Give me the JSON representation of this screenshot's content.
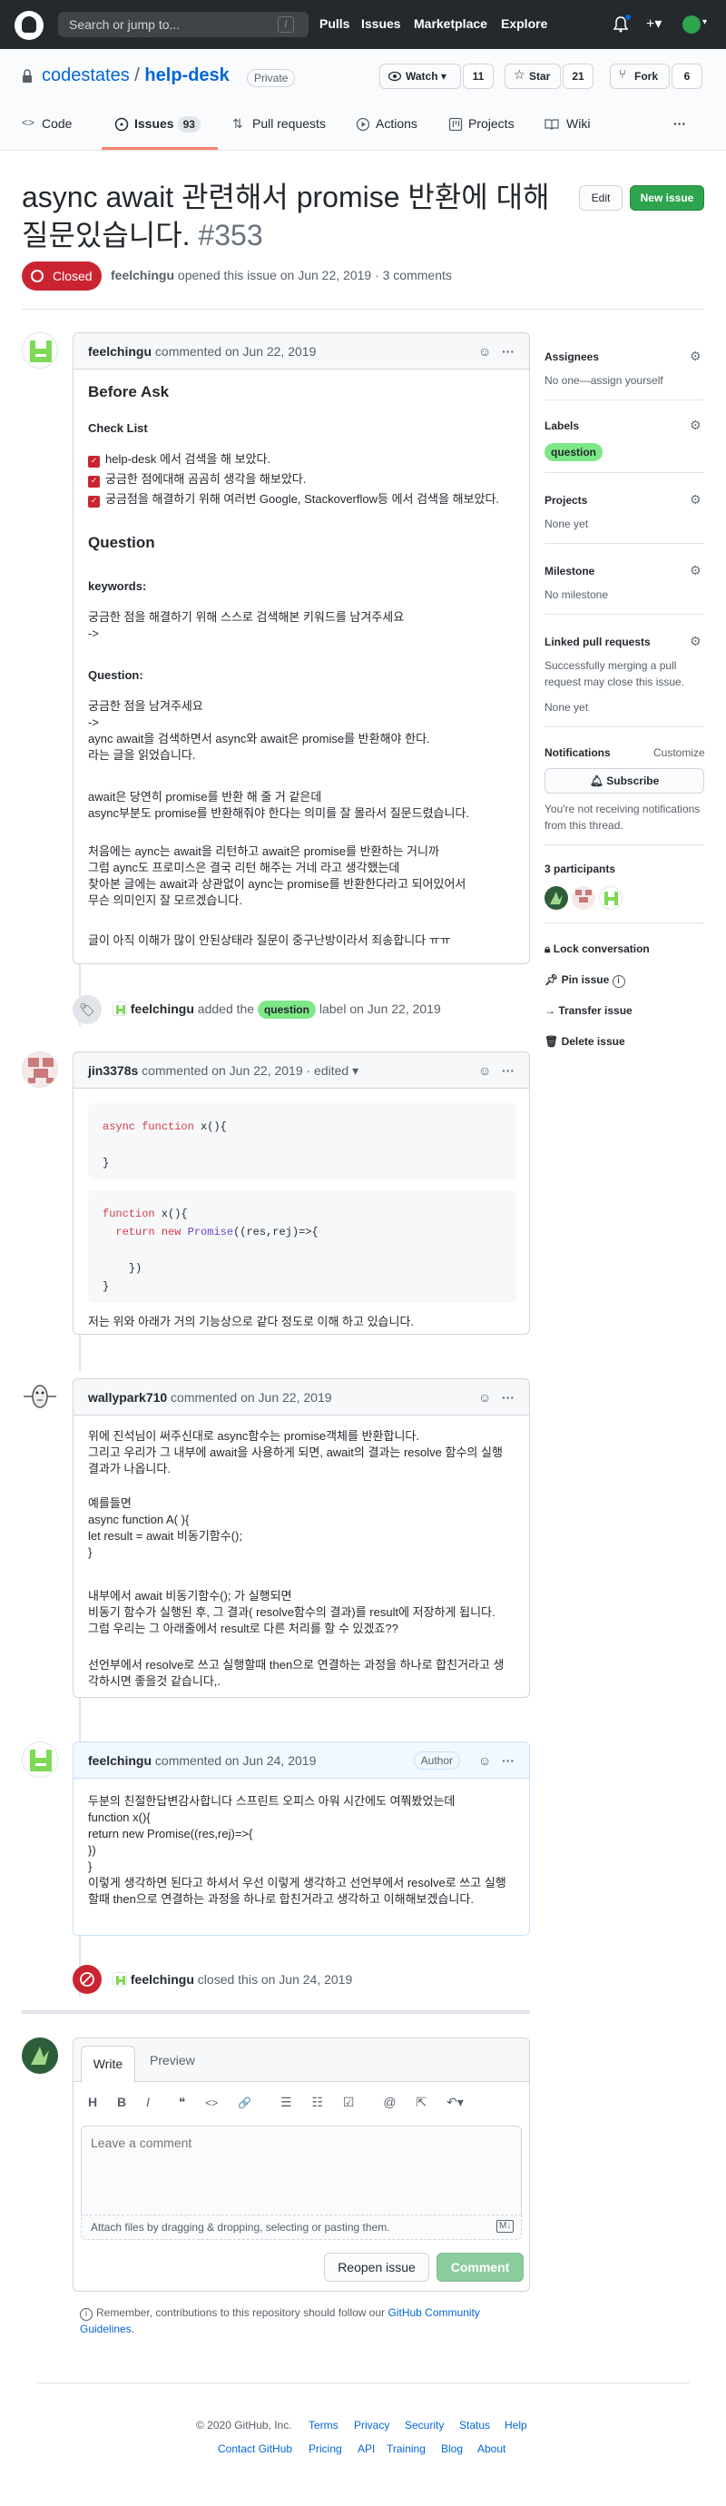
{
  "header": {
    "search_placeholder": "Search or jump to...",
    "search_key": "/",
    "nav": [
      "Pulls",
      "Issues",
      "Marketplace",
      "Explore"
    ]
  },
  "repo": {
    "owner": "codestates",
    "sep": "/",
    "name": "help-desk",
    "visibility": "Private",
    "watch_label": "Watch",
    "watch_count": "11",
    "star_label": "Star",
    "star_count": "21",
    "fork_label": "Fork",
    "fork_count": "6",
    "tabs": [
      {
        "label": "Code"
      },
      {
        "label": "Issues",
        "count": "93"
      },
      {
        "label": "Pull requests"
      },
      {
        "label": "Actions"
      },
      {
        "label": "Projects"
      },
      {
        "label": "Wiki"
      }
    ],
    "more": "···"
  },
  "issue": {
    "title": "async await 관련해서 promise 반환에 대해 질문있습니다.",
    "number": "#353",
    "edit_label": "Edit",
    "new_issue_label": "New issue",
    "state": "Closed",
    "author": "feelchingu",
    "meta_text": " opened this issue on Jun 22, 2019 · 3 comments"
  },
  "comments": [
    {
      "author": "feelchingu",
      "meta": " commented on Jun 22, 2019",
      "h_before": "Before Ask",
      "checklist_title": "Check List",
      "checklist": [
        "help-desk 에서 검색을 해 보았다.",
        "궁금한 점에대해 곰곰히 생각을 해보았다.",
        "궁금점을 해결하기 위해 여러번 Google, Stackoverflow등 에서 검색을 해보았다."
      ],
      "h_question": "Question",
      "keywords_label": "keywords:",
      "keywords_lines": [
        "궁금한 점을 해결하기 위해 스스로 검색해본 키워드를 남겨주세요",
        "->"
      ],
      "question_label": "Question:",
      "para1": [
        "궁금한 점을 남겨주세요",
        "->",
        "aync await을 검색하면서 async와 await은 promise를 반환해야 한다.",
        "라는 글을 읽었습니다."
      ],
      "para2": [
        "await은 당연히 promise를 반환 해 줄 거 같은데",
        "async부분도 promise를 반환해줘야 한다는 의미를 잘 몰라서 질문드렸습니다."
      ],
      "para3": [
        "처음에는 aync는 await을 리턴하고 await은 promise를 반환하는 거니까",
        "그럼 aync도 프로미스은 결국 리턴 해주는 거네 라고 생각했는데",
        "찾아본 글에는 await과 상관없이 aync는 promise를 반환한다라고 되어있어서",
        "무슨 의미인지 잘 모르겠습니다."
      ],
      "para4": "글이 아직 이해가 많이 안된상태라 질문이 중구난방이라서 죄송합니다 ㅠㅠ"
    },
    {
      "author": "jin3378s",
      "meta": " commented on Jun 22, 2019 · edited ▾",
      "code1": {
        "kw": "async",
        "fn": "function",
        "rest": " x(){",
        "close": "}"
      },
      "code2": {
        "fn": "function",
        "rest": " x(){",
        "ret": "return",
        "new": "new",
        "cls": "Promise",
        "args": "((res,rej)=>{",
        "close1": "})",
        "close2": "}"
      },
      "text": "저는 위와 아래가 거의 기능상으로 같다 정도로 이해 하고 있습니다."
    },
    {
      "author": "wallypark710",
      "meta": " commented on Jun 22, 2019",
      "p1": [
        "위에 진석님이 써주신대로 async함수는 promise객체를 반환합니다.",
        "그리고 우리가 그 내부에 await을 사용하게 되면, await의 결과는 resolve 함수의 실행",
        "결과가 나옵니다."
      ],
      "p2": [
        "예를들면",
        "async function A( ){",
        "let result = await 비동기함수();",
        "}"
      ],
      "p3": [
        "내부에서 await 비동기함수(); 가 실행되면",
        "비동기 함수가 실행된 후, 그 결과( resolve함수의 결과)를 result에 저장하게 됩니다.",
        "그럼 우리는 그 아래줄에서 result로 다른 처리를 할 수 있겠죠??"
      ],
      "p4": [
        "선언부에서 resolve로 쓰고 실행할때 then으로 연결하는 과정을 하나로 합친거라고 생",
        "각하시면 좋을것 같습니다,."
      ]
    },
    {
      "author": "feelchingu",
      "meta": " commented on Jun 24, 2019",
      "role": "Author",
      "lines": [
        "두분의 친절한답변감사합니다 스프린트 오피스 아워 시간에도 여쭤봤었는데",
        "function x(){",
        "return new Promise((res,rej)=>{",
        "})",
        "}",
        "이렇게 생각하면 된다고 하셔서 우선 이렇게 생각하고 선언부에서 resolve로 쓰고 실행",
        "할때 then으로 연결하는 과정을 하나로 합친거라고 생각하고 이해해보겠습니다."
      ]
    }
  ],
  "events": {
    "labeled": {
      "actor": "feelchingu",
      "pre": " added the ",
      "label": "question",
      "post": " label on Jun 22, 2019"
    },
    "closed": {
      "actor": "feelchingu",
      "text": " closed this on Jun 24, 2019"
    }
  },
  "editor": {
    "tab_write": "Write",
    "tab_preview": "Preview",
    "tools": [
      "H",
      "B",
      "I",
      "❝",
      "<>",
      "🔗",
      "☰",
      "☷",
      "☑",
      "@",
      "⇱",
      "↶▾"
    ],
    "placeholder": "Leave a comment",
    "attach": "Attach files by dragging & dropping, selecting or pasting them.",
    "md_badge": "M↓",
    "reopen_label": "Reopen issue",
    "comment_label": "Comment",
    "notice": "Remember, contributions to this repository should follow our ",
    "notice_link": "GitHub Community Guidelines",
    "notice_end": "."
  },
  "sidebar": {
    "assignees_h": "Assignees",
    "assignees_t": "No one—assign yourself",
    "labels_h": "Labels",
    "label": "question",
    "projects_h": "Projects",
    "projects_t": "None yet",
    "milestone_h": "Milestone",
    "milestone_t": "No milestone",
    "linked_h": "Linked pull requests",
    "linked_desc": [
      "Successfully merging a pull",
      "request may close this issue."
    ],
    "linked_t": "None yet",
    "notif_h": "Notifications",
    "customize": "Customize",
    "subscribe": "Subscribe",
    "notif_desc": [
      "You're not receiving notifications",
      "from this thread."
    ],
    "participants": "3 participants",
    "lock": "Lock conversation",
    "pin": "Pin issue",
    "transfer": "Transfer issue",
    "delete": "Delete issue"
  },
  "footer": {
    "copyright": "© 2020 GitHub, Inc.",
    "row1": [
      "Terms",
      "Privacy",
      "Security",
      "Status",
      "Help"
    ],
    "row2": [
      "Contact GitHub",
      "Pricing",
      "API",
      "Training",
      "Blog",
      "About"
    ]
  },
  "colors": {
    "header": "#24292e",
    "closed": "#cb2431",
    "green": "#2ea44f",
    "link": "#0366d6",
    "label": "#7ee787"
  }
}
